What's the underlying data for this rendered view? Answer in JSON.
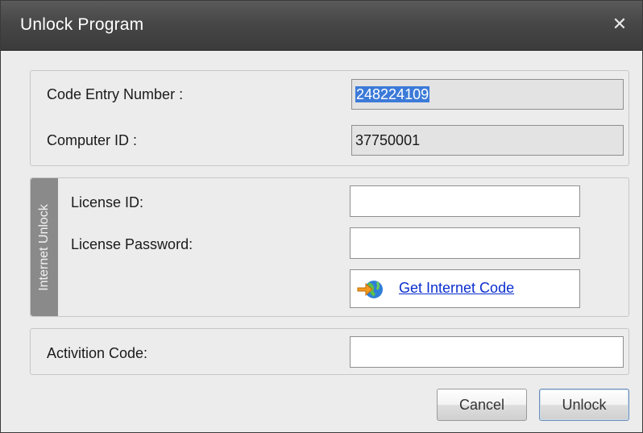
{
  "window": {
    "title": "Unlock Program",
    "close_icon": "close-icon"
  },
  "info_panel": {
    "code_entry_label": "Code Entry Number :",
    "code_entry_value": "248224109",
    "computer_id_label": "Computer ID :",
    "computer_id_value": "37750001"
  },
  "internet_unlock": {
    "section_label": "Internet Unlock",
    "license_id_label": "License ID:",
    "license_id_value": "",
    "license_password_label": "License Password:",
    "license_password_value": "",
    "get_code_link": "Get Internet Code",
    "get_code_icon": "globe-arrow-icon"
  },
  "activation": {
    "label": "Activition Code:",
    "value": ""
  },
  "buttons": {
    "cancel": "Cancel",
    "unlock": "Unlock"
  },
  "colors": {
    "titlebar": "#474747",
    "selection": "#3c7ad8",
    "link": "#0b2fcf",
    "sidebar": "#8a8a8a"
  }
}
